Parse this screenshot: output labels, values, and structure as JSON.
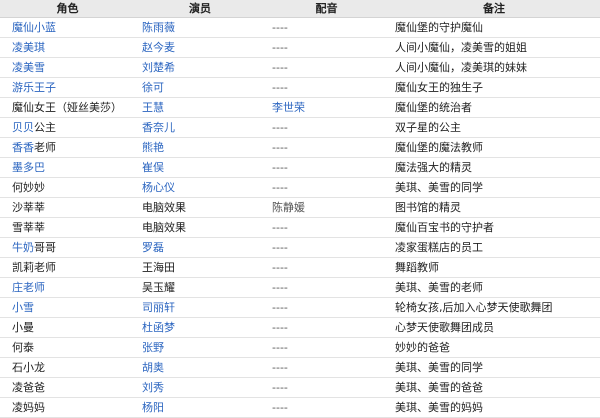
{
  "colors": {
    "link": "#2b65c0",
    "header_bg": "#eaeaea",
    "row_border": "#e3e3e3",
    "text": "#222222"
  },
  "table": {
    "columns": [
      "角色",
      "演员",
      "配音",
      "备注"
    ],
    "rows": [
      {
        "role": [
          {
            "text": "魔仙小蓝",
            "link": true
          }
        ],
        "actor": [
          {
            "text": "陈雨薇",
            "link": true
          }
        ],
        "voice": [
          {
            "text": "----",
            "link": false
          }
        ],
        "note": [
          {
            "text": "魔仙堡的守护魔仙",
            "link": false
          }
        ]
      },
      {
        "role": [
          {
            "text": "凌美琪",
            "link": true
          }
        ],
        "actor": [
          {
            "text": "赵今麦",
            "link": true
          }
        ],
        "voice": [
          {
            "text": "----",
            "link": false
          }
        ],
        "note": [
          {
            "text": "人间小魔仙，凌美雪的姐姐",
            "link": false
          }
        ]
      },
      {
        "role": [
          {
            "text": "凌美雪",
            "link": true
          }
        ],
        "actor": [
          {
            "text": "刘楚希",
            "link": true
          }
        ],
        "voice": [
          {
            "text": "----",
            "link": false
          }
        ],
        "note": [
          {
            "text": "人间小魔仙，凌美琪的妹妹",
            "link": false
          }
        ]
      },
      {
        "role": [
          {
            "text": "游乐王子",
            "link": true
          }
        ],
        "actor": [
          {
            "text": "徐可",
            "link": true
          }
        ],
        "voice": [
          {
            "text": "----",
            "link": false
          }
        ],
        "note": [
          {
            "text": "魔仙女王的独生子",
            "link": false
          }
        ]
      },
      {
        "role": [
          {
            "text": "魔仙女王（娅丝美莎）",
            "link": false
          }
        ],
        "actor": [
          {
            "text": "王慧",
            "link": true
          }
        ],
        "voice": [
          {
            "text": "李世荣",
            "link": true
          }
        ],
        "note": [
          {
            "text": "魔仙堡的统治者",
            "link": false
          }
        ]
      },
      {
        "role": [
          {
            "text": "贝贝",
            "link": true
          },
          {
            "text": "公主",
            "link": false
          }
        ],
        "actor": [
          {
            "text": "香奈儿",
            "link": true
          }
        ],
        "voice": [
          {
            "text": "----",
            "link": false
          }
        ],
        "note": [
          {
            "text": "双子星的公主",
            "link": false
          }
        ]
      },
      {
        "role": [
          {
            "text": "香香",
            "link": true
          },
          {
            "text": "老师",
            "link": false
          }
        ],
        "actor": [
          {
            "text": "熊艳",
            "link": true
          }
        ],
        "voice": [
          {
            "text": "----",
            "link": false
          }
        ],
        "note": [
          {
            "text": "魔仙堡的魔法教师",
            "link": false
          }
        ]
      },
      {
        "role": [
          {
            "text": "墨多巴",
            "link": true
          }
        ],
        "actor": [
          {
            "text": "崔俣",
            "link": true
          }
        ],
        "voice": [
          {
            "text": "----",
            "link": false
          }
        ],
        "note": [
          {
            "text": "魔法强大的精灵",
            "link": false
          }
        ]
      },
      {
        "role": [
          {
            "text": "何妙妙",
            "link": false
          }
        ],
        "actor": [
          {
            "text": "杨心仪",
            "link": true
          }
        ],
        "voice": [
          {
            "text": "----",
            "link": false
          }
        ],
        "note": [
          {
            "text": "美琪、美雪的同学",
            "link": false
          }
        ]
      },
      {
        "role": [
          {
            "text": "沙莘莘",
            "link": false
          }
        ],
        "actor": [
          {
            "text": "电脑效果",
            "link": false
          }
        ],
        "voice": [
          {
            "text": "陈静媛",
            "link": false
          }
        ],
        "note": [
          {
            "text": "图书馆的精灵",
            "link": false
          }
        ]
      },
      {
        "role": [
          {
            "text": "雪莘莘",
            "link": false
          }
        ],
        "actor": [
          {
            "text": "电脑效果",
            "link": false
          }
        ],
        "voice": [
          {
            "text": "----",
            "link": false
          }
        ],
        "note": [
          {
            "text": "魔仙百宝书的守护者",
            "link": false
          }
        ]
      },
      {
        "role": [
          {
            "text": "牛奶",
            "link": true
          },
          {
            "text": "哥哥",
            "link": false
          }
        ],
        "actor": [
          {
            "text": "罗磊",
            "link": true
          }
        ],
        "voice": [
          {
            "text": "----",
            "link": false
          }
        ],
        "note": [
          {
            "text": "凌家蛋糕店的员工",
            "link": false
          }
        ]
      },
      {
        "role": [
          {
            "text": "凯莉老师",
            "link": false
          }
        ],
        "actor": [
          {
            "text": "王海田",
            "link": false
          }
        ],
        "voice": [
          {
            "text": "----",
            "link": false
          }
        ],
        "note": [
          {
            "text": "舞蹈教师",
            "link": false
          }
        ]
      },
      {
        "role": [
          {
            "text": "庄老师",
            "link": true
          }
        ],
        "actor": [
          {
            "text": "吴玉耀",
            "link": false
          }
        ],
        "voice": [
          {
            "text": "----",
            "link": false
          }
        ],
        "note": [
          {
            "text": "美琪、美雪的老师",
            "link": false
          }
        ]
      },
      {
        "role": [
          {
            "text": "小雪",
            "link": true
          }
        ],
        "actor": [
          {
            "text": "司丽轩",
            "link": true
          }
        ],
        "voice": [
          {
            "text": "----",
            "link": false
          }
        ],
        "note": [
          {
            "text": "轮椅女孩,后加入心梦天使歌舞团",
            "link": false
          }
        ]
      },
      {
        "role": [
          {
            "text": "小曼",
            "link": false
          }
        ],
        "actor": [
          {
            "text": "杜函梦",
            "link": true
          }
        ],
        "voice": [
          {
            "text": "----",
            "link": false
          }
        ],
        "note": [
          {
            "text": "心梦天使歌舞团成员",
            "link": false
          }
        ]
      },
      {
        "role": [
          {
            "text": "何泰",
            "link": false
          }
        ],
        "actor": [
          {
            "text": "张野",
            "link": true
          }
        ],
        "voice": [
          {
            "text": "----",
            "link": false
          }
        ],
        "note": [
          {
            "text": "妙妙的爸爸",
            "link": false
          }
        ]
      },
      {
        "role": [
          {
            "text": "石小龙",
            "link": false
          }
        ],
        "actor": [
          {
            "text": "胡奥",
            "link": true
          }
        ],
        "voice": [
          {
            "text": "----",
            "link": false
          }
        ],
        "note": [
          {
            "text": "美琪、美雪的同学",
            "link": false
          }
        ]
      },
      {
        "role": [
          {
            "text": "凌爸爸",
            "link": false
          }
        ],
        "actor": [
          {
            "text": "刘秀",
            "link": true
          }
        ],
        "voice": [
          {
            "text": "----",
            "link": false
          }
        ],
        "note": [
          {
            "text": "美琪、美雪的爸爸",
            "link": false
          }
        ]
      },
      {
        "role": [
          {
            "text": "凌妈妈",
            "link": false
          }
        ],
        "actor": [
          {
            "text": "杨阳",
            "link": true
          }
        ],
        "voice": [
          {
            "text": "----",
            "link": false
          }
        ],
        "note": [
          {
            "text": "美琪、美雪的妈妈",
            "link": false
          }
        ]
      }
    ]
  }
}
